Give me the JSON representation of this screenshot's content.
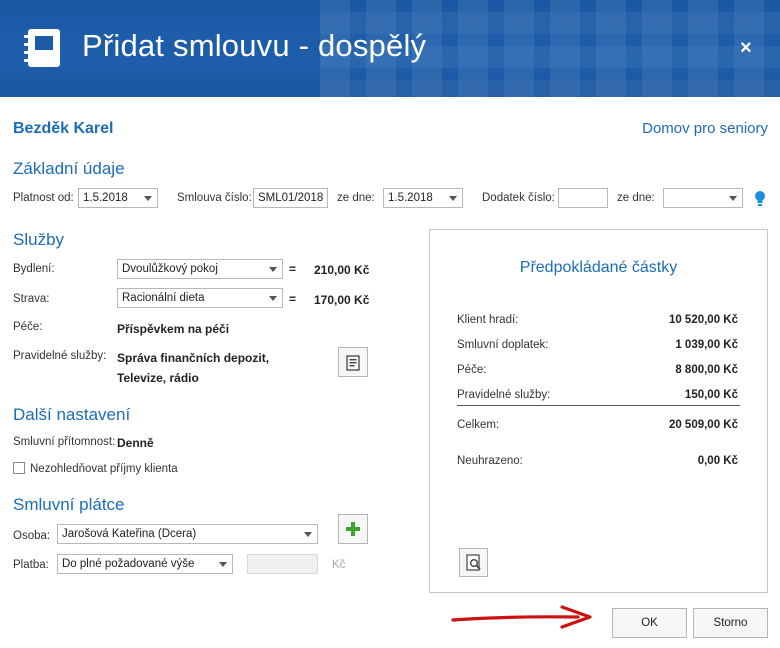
{
  "dialog": {
    "title": "Přidat smlouvu - dospělý",
    "close_label": "×"
  },
  "client": {
    "name": "Bezděk Karel",
    "facility": "Domov pro seniory"
  },
  "basic": {
    "heading": "Základní údaje",
    "validity_label": "Platnost od:",
    "validity_value": "1.5.2018",
    "contract_no_label": "Smlouva číslo:",
    "contract_no_value": "SML01/2018",
    "date_label": "ze dne:",
    "date_value": "1.5.2018",
    "amendment_label": "Dodatek číslo:",
    "amendment_value": "",
    "amendment_date_label": "ze dne:",
    "amendment_date_value": ""
  },
  "services": {
    "heading": "Služby",
    "housing_label": "Bydlení:",
    "housing_value": "Dvoulůžkový pokoj",
    "housing_eq": "=",
    "housing_price": "210,00 Kč",
    "food_label": "Strava:",
    "food_value": "Racionální dieta",
    "food_eq": "=",
    "food_price": "170,00 Kč",
    "care_label": "Péče:",
    "care_value": "Příspěvkem na péči",
    "regular_label": "Pravidelné služby:",
    "regular_value_1": "Správa finančních depozit,",
    "regular_value_2": "Televize, rádio"
  },
  "more": {
    "heading": "Další nastavení",
    "presence_label": "Smluvní přítomnost:",
    "presence_value": "Denně",
    "ignore_income_label": "Nezohledňovat příjmy klienta",
    "ignore_income_checked": false
  },
  "payer": {
    "heading": "Smluvní plátce",
    "person_label": "Osoba:",
    "person_value": "Jarošová Kateřina (Dcera)",
    "payment_label": "Platba:",
    "payment_value": "Do plné požadované výše",
    "amount_value": "",
    "currency": "Kč"
  },
  "summary": {
    "heading": "Předpokládané částky",
    "rows": [
      {
        "label": "Klient hradí:",
        "value": "10 520,00 Kč"
      },
      {
        "label": "Smluvní doplatek:",
        "value": "1 039,00 Kč"
      },
      {
        "label": "Péče:",
        "value": "8 800,00 Kč"
      },
      {
        "label": "Pravidelné služby:",
        "value": "150,00 Kč"
      }
    ],
    "total_label": "Celkem:",
    "total_value": "20 509,00 Kč",
    "unpaid_label": "Neuhrazeno:",
    "unpaid_value": "0,00 Kč"
  },
  "footer": {
    "ok_label": "OK",
    "cancel_label": "Storno"
  },
  "colors": {
    "header": "#1c5ba6",
    "accent": "#1c6cb8",
    "arrow": "#cc1111",
    "add_green": "#3aa52d"
  }
}
